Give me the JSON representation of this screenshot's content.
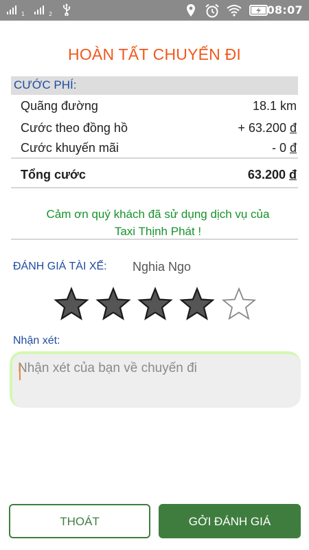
{
  "status_bar": {
    "sim1_label": "1",
    "sim2_label": "2",
    "time": "08:07"
  },
  "title": "HOÀN TẤT CHUYẾN ĐI",
  "fee": {
    "header": "CƯỚC PHÍ:",
    "rows": [
      {
        "label": "Quãng đường",
        "value": "18.1 km"
      },
      {
        "label": "Cước theo đồng hồ",
        "value": "+ 63.200",
        "currency": "đ"
      },
      {
        "label": "Cước khuyến mãi",
        "value": "- 0",
        "currency": "đ"
      }
    ],
    "total": {
      "label": "Tổng cước",
      "value": "63.200",
      "currency": "đ"
    }
  },
  "thanks_line1": "Cảm ơn quý khách đã sử dụng dịch vụ của",
  "thanks_line2": "Taxi Thịnh Phát !",
  "rating": {
    "label": "ĐÁNH GIÁ TÀI XẾ:",
    "driver_name": "Nghia Ngo",
    "value": 4,
    "max": 5
  },
  "comment": {
    "label": "Nhận xét:",
    "placeholder": "Nhận xét của bạn về chuyến đi",
    "value": ""
  },
  "buttons": {
    "exit": "THOÁT",
    "submit": "GỞI ĐÁNH GIÁ"
  },
  "colors": {
    "title": "#f1571c",
    "section_blue": "#1e4ba0",
    "thanks_green": "#17922b",
    "primary_green": "#3f7d3f",
    "status_bar": "#8a8a8a"
  }
}
